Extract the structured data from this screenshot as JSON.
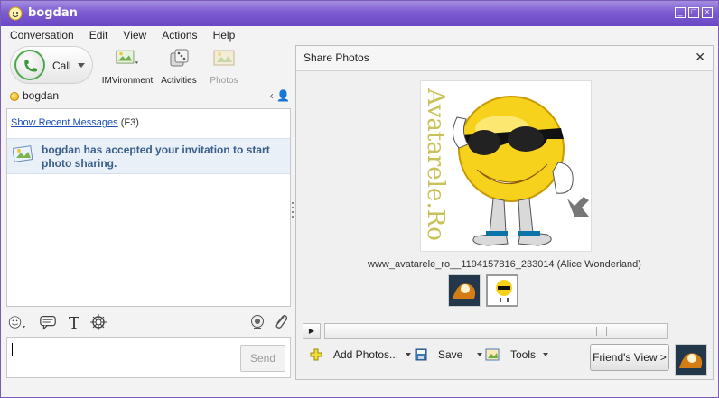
{
  "window": {
    "title": "bogdan",
    "accent": "#7d5bd2"
  },
  "menu": {
    "items": [
      "Conversation",
      "Edit",
      "View",
      "Actions",
      "Help"
    ]
  },
  "toolbar": {
    "call_label": "Call",
    "imvironment_label": "IMVironment",
    "activities_label": "Activities",
    "photos_label": "Photos"
  },
  "contact": {
    "name": "bogdan",
    "status_color": "#e9a800"
  },
  "conversation": {
    "recent_link": "Show Recent Messages",
    "recent_hint": "(F3)",
    "notice": "bogdan has accepted your invitation to start photo sharing."
  },
  "compose": {
    "send_label": "Send"
  },
  "share": {
    "title": "Share Photos",
    "image_watermark": "Avatarele.Ro",
    "caption": "www_avatarele_ro__1194157816_233014 (Alice Wonderland)",
    "add_photos_label": "Add Photos...",
    "save_label": "Save",
    "tools_label": "Tools",
    "friends_view_label": "Friend's View >"
  },
  "icons": {
    "title": "messenger-icon",
    "call": "phone-icon",
    "imvironment": "imvironment-icon",
    "activities": "activities-icon",
    "photos": "photos-icon",
    "emoticon": "emoticon-icon",
    "bubble": "speech-bubble-icon",
    "font": "font-icon",
    "audibles": "audibles-icon",
    "webcam": "webcam-icon",
    "attach": "paperclip-icon"
  }
}
